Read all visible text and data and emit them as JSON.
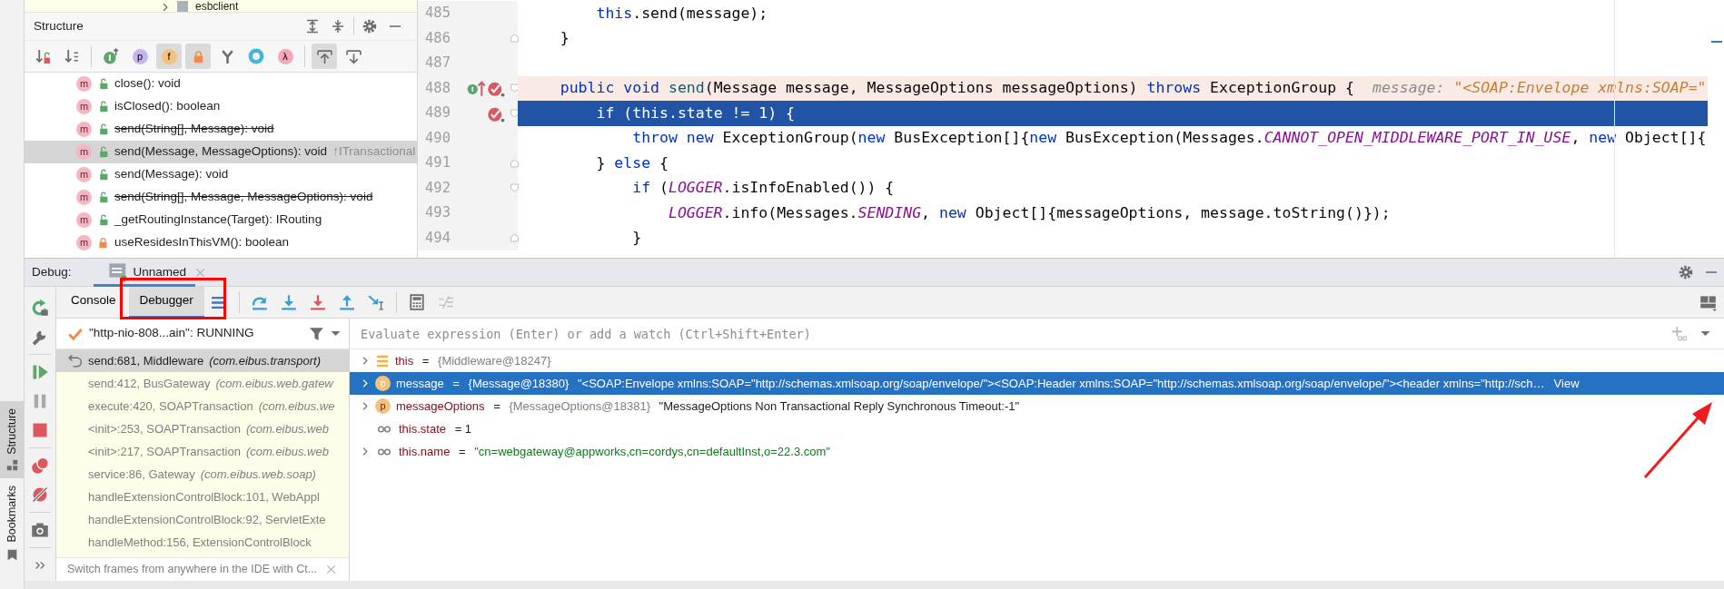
{
  "side_strip": {
    "tabs": [
      {
        "label": "Structure",
        "selected": true
      },
      {
        "label": "Bookmarks",
        "selected": false
      }
    ]
  },
  "project_tree": {
    "item": "esbclient"
  },
  "structure": {
    "title": "Structure",
    "toolbar": [
      {
        "kind": "sort-visibility",
        "on": false
      },
      {
        "kind": "sort-alpha",
        "on": false
      },
      {
        "kind": "inherited",
        "on": false
      },
      {
        "kind": "properties",
        "glyph": "p",
        "on": false
      },
      {
        "kind": "fields",
        "glyph": "f",
        "on": true
      },
      {
        "kind": "non-public",
        "on": true
      },
      {
        "kind": "hierarchy",
        "on": false
      },
      {
        "kind": "anonymous",
        "on": false
      },
      {
        "kind": "lambdas",
        "glyph": "λ",
        "on": false
      },
      {
        "kind": "autoscroll-to-source",
        "on": true
      },
      {
        "kind": "autoscroll-from-source",
        "on": false
      }
    ],
    "items": [
      {
        "badge": "m",
        "locked": false,
        "label": "close(): void",
        "deprecated": false,
        "selected": false
      },
      {
        "badge": "m",
        "locked": false,
        "label": "isClosed(): boolean",
        "deprecated": false,
        "selected": false
      },
      {
        "badge": "m",
        "locked": false,
        "label": "send(String[], Message): void",
        "deprecated": true,
        "selected": false
      },
      {
        "badge": "m",
        "locked": false,
        "label": "send(Message, MessageOptions): void",
        "suffix": "↑ITransactional",
        "deprecated": false,
        "selected": true
      },
      {
        "badge": "m",
        "locked": false,
        "label": "send(Message): void",
        "deprecated": false,
        "selected": false
      },
      {
        "badge": "m",
        "locked": false,
        "label": "send(String[], Message, MessageOptions): void",
        "deprecated": true,
        "selected": false
      },
      {
        "badge": "m",
        "locked": false,
        "label": "_getRoutingInstance(Target): IRouting",
        "deprecated": false,
        "selected": false
      },
      {
        "badge": "m",
        "locked": true,
        "label": "useResidesInThisVM(): boolean",
        "deprecated": false,
        "selected": false
      }
    ]
  },
  "editor": {
    "lines": [
      {
        "number": "485",
        "kind": "normal",
        "implements": false,
        "breakpoint": false,
        "fold_start": false,
        "fold_end": false,
        "tokens": [
          {
            "text": "        this",
            "kind": "keyword"
          },
          {
            "text": ".send(message);",
            "kind": "plain"
          }
        ]
      },
      {
        "number": "486",
        "kind": "normal",
        "implements": false,
        "breakpoint": false,
        "fold_start": false,
        "fold_end": true,
        "tokens": [
          {
            "text": "    }",
            "kind": "plain"
          }
        ]
      },
      {
        "number": "487",
        "kind": "normal",
        "implements": false,
        "breakpoint": false,
        "fold_start": false,
        "fold_end": false
      },
      {
        "number": "488",
        "kind": "method-header",
        "implements": true,
        "breakpoint": true,
        "fold_start": true,
        "fold_end": false,
        "tokens": [
          {
            "text": "    public void ",
            "kind": "keyword"
          },
          {
            "text": "send",
            "kind": "declaration"
          },
          {
            "text": "(Message message, MessageOptions messageOptions) ",
            "kind": "plain"
          },
          {
            "text": "throws",
            "kind": "keyword"
          },
          {
            "text": " ExceptionGroup {",
            "kind": "plain"
          }
        ],
        "inline_hint": {
          "label": "message: ",
          "value": "\"<SOAP:Envelope xmlns:SOAP=\""
        }
      },
      {
        "number": "489",
        "kind": "execution-point",
        "implements": false,
        "breakpoint": true,
        "fold_start": true,
        "fold_end": false,
        "tokens": [
          {
            "text": "        if",
            "kind": "keyword"
          },
          {
            "text": " (",
            "kind": "plain"
          },
          {
            "text": "this",
            "kind": "keyword"
          },
          {
            "text": ".state != 1) {",
            "kind": "plain"
          }
        ]
      },
      {
        "number": "490",
        "kind": "normal",
        "implements": false,
        "breakpoint": false,
        "fold_start": false,
        "fold_end": false,
        "tokens": [
          {
            "text": "            throw new",
            "kind": "keyword"
          },
          {
            "text": " ExceptionGroup(",
            "kind": "plain"
          },
          {
            "text": "new",
            "kind": "keyword"
          },
          {
            "text": " BusException[]{",
            "kind": "plain"
          },
          {
            "text": "new",
            "kind": "keyword"
          },
          {
            "text": " BusException(Messages.",
            "kind": "plain"
          },
          {
            "text": "CANNOT_OPEN_MIDDLEWARE_PORT_IN_USE",
            "kind": "static"
          },
          {
            "text": ", ",
            "kind": "plain"
          },
          {
            "text": "new",
            "kind": "keyword"
          },
          {
            "text": " Object[]{",
            "kind": "plain"
          }
        ]
      },
      {
        "number": "491",
        "kind": "normal",
        "implements": false,
        "breakpoint": false,
        "fold_start": false,
        "fold_end": true,
        "tokens": [
          {
            "text": "        } ",
            "kind": "plain"
          },
          {
            "text": "else",
            "kind": "keyword"
          },
          {
            "text": " {",
            "kind": "plain"
          }
        ]
      },
      {
        "number": "492",
        "kind": "normal",
        "implements": false,
        "breakpoint": false,
        "fold_start": true,
        "fold_end": false,
        "tokens": [
          {
            "text": "            if",
            "kind": "keyword"
          },
          {
            "text": " (",
            "kind": "plain"
          },
          {
            "text": "LOGGER",
            "kind": "static"
          },
          {
            "text": ".isInfoEnabled()) {",
            "kind": "plain"
          }
        ]
      },
      {
        "number": "493",
        "kind": "normal",
        "implements": false,
        "breakpoint": false,
        "fold_start": false,
        "fold_end": false,
        "tokens": [
          {
            "text": "                LOGGER",
            "kind": "static"
          },
          {
            "text": ".info(Messages.",
            "kind": "plain"
          },
          {
            "text": "SENDING",
            "kind": "static"
          },
          {
            "text": ", ",
            "kind": "plain"
          },
          {
            "text": "new",
            "kind": "keyword"
          },
          {
            "text": " Object[]{messageOptions, message.toString()});",
            "kind": "plain"
          }
        ]
      },
      {
        "number": "494",
        "kind": "normal",
        "implements": false,
        "breakpoint": false,
        "fold_start": false,
        "fold_end": true,
        "tokens": [
          {
            "text": "            }",
            "kind": "plain"
          }
        ]
      }
    ]
  },
  "debug": {
    "label": "Debug:",
    "session_tab": {
      "label": "Unnamed",
      "selected": true
    },
    "side_actions": [
      {
        "kind": "rerun",
        "disabled": false
      },
      {
        "kind": "wrench",
        "disabled": false
      },
      {
        "kind": "resume",
        "disabled": false
      },
      {
        "kind": "pause",
        "disabled": true
      },
      {
        "kind": "stop",
        "disabled": false
      },
      {
        "kind": "breakpoints",
        "disabled": false
      },
      {
        "kind": "mute-breakpoints",
        "disabled": false
      },
      {
        "kind": "snapshot",
        "disabled": false
      },
      {
        "kind": "more",
        "disabled": false
      }
    ],
    "tabs": [
      {
        "label": "Console",
        "selected": false
      },
      {
        "label": "Debugger",
        "selected": true
      }
    ],
    "toolbar": [
      {
        "kind": "frames-menu",
        "disabled": false
      },
      {
        "kind": "step-over",
        "disabled": false
      },
      {
        "kind": "step-into",
        "disabled": false
      },
      {
        "kind": "force-step-into",
        "disabled": false
      },
      {
        "kind": "step-out",
        "disabled": false
      },
      {
        "kind": "run-to-cursor",
        "disabled": false
      },
      {
        "kind": "evaluate",
        "disabled": false
      },
      {
        "kind": "trace",
        "disabled": true
      }
    ],
    "thread": {
      "label": "\"http-nio-808...ain\": RUNNING"
    },
    "frames": [
      {
        "location": "send:681, Middleware",
        "package": "(com.eibus.transport)",
        "kind": "current",
        "selected": true
      },
      {
        "location": "send:412, BusGateway",
        "package": "(com.eibus.web.gatew",
        "kind": "library",
        "selected": false
      },
      {
        "location": "execute:420, SOAPTransaction",
        "package": "(com.eibus.we",
        "kind": "library",
        "selected": false
      },
      {
        "location": "<init>:253, SOAPTransaction",
        "package": "(com.eibus.web",
        "kind": "library",
        "selected": false
      },
      {
        "location": "<init>:217, SOAPTransaction",
        "package": "(com.eibus.web",
        "kind": "library",
        "selected": false
      },
      {
        "location": "service:86, Gateway",
        "package": "(com.eibus.web.soap)",
        "kind": "library",
        "selected": false
      },
      {
        "location": "handleExtensionControlBlock:101, WebAppl",
        "kind": "library",
        "selected": false
      },
      {
        "location": "handleExtensionControlBlock:92, ServletExte",
        "kind": "library",
        "selected": false
      },
      {
        "location": "handleMethod:156, ExtensionControlBlock",
        "kind": "library",
        "selected": false
      }
    ],
    "hint": "Switch frames from anywhere in the IDE with Ct...",
    "evaluate": {
      "placeholder": "Evaluate expression (Enter) or add a watch (Ctrl+Shift+Enter)"
    },
    "variables": [
      {
        "kind": "field",
        "expandable": true,
        "selected": false,
        "tokens": [
          {
            "text": "this",
            "kind": "name"
          },
          {
            "text": " = ",
            "kind": "plain"
          },
          {
            "text": "{Middleware@18247}",
            "kind": "ref"
          }
        ]
      },
      {
        "kind": "parameter",
        "badge": "p",
        "expandable": true,
        "selected": true,
        "link": "View",
        "tokens": [
          {
            "text": "message",
            "kind": "name"
          },
          {
            "text": " = ",
            "kind": "plain"
          },
          {
            "text": "{Message@18380}",
            "kind": "ref"
          },
          {
            "text": " \"<SOAP:Envelope xmlns:SOAP=\"http://schemas.xmlsoap.org/soap/envelope/\"><SOAP:Header xmlns:SOAP=\"http://schemas.xmlsoap.org/soap/envelope/\"><header xmlns=\"http://sch…",
            "kind": "plain"
          }
        ]
      },
      {
        "kind": "parameter",
        "badge": "p",
        "expandable": true,
        "selected": false,
        "tokens": [
          {
            "text": "messageOptions",
            "kind": "name"
          },
          {
            "text": " = ",
            "kind": "plain"
          },
          {
            "text": "{MessageOptions@18381}",
            "kind": "ref"
          },
          {
            "text": " \"MessageOptions Non Transactional Reply Synchronous Timeout:-1\"",
            "kind": "plain"
          }
        ]
      },
      {
        "kind": "watch",
        "expandable": false,
        "selected": false,
        "tokens": [
          {
            "text": "this.state",
            "kind": "name"
          },
          {
            "text": " = 1",
            "kind": "plain"
          }
        ]
      },
      {
        "kind": "watch",
        "expandable": true,
        "selected": false,
        "tokens": [
          {
            "text": "this.name",
            "kind": "name"
          },
          {
            "text": " = ",
            "kind": "plain"
          },
          {
            "text": "\"cn=webgateway@appworks,cn=cordys,cn=defaultInst,o=22.3.com\"",
            "kind": "string"
          }
        ]
      }
    ]
  }
}
